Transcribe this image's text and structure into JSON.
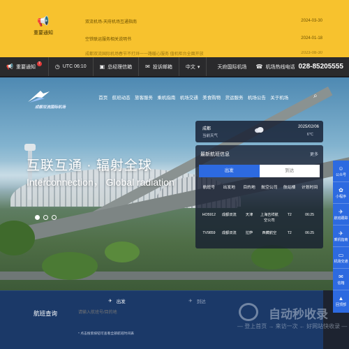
{
  "notice": {
    "label": "重要通知",
    "icon": "megaphone-icon",
    "items": [
      {
        "title": "",
        "date": ""
      },
      {
        "title": "双流机场-天府机场互通指南",
        "date": "2024-03-30"
      },
      {
        "title": "空铁联运服务相关说明书",
        "date": "2024-01-18"
      },
      {
        "title": "成都双流国际机场春节不打烊一一路暖心服务 值机柜台全面开放",
        "date": "2023-08-30"
      }
    ]
  },
  "infobar": {
    "notice": "重要通知",
    "badge": "7",
    "utc": "UTC 06:10",
    "complaint": "总经理信箱",
    "report": "投诉邮箱",
    "lang": "中文",
    "airport": "天府国际机场",
    "hotline_label": "机场热线电话",
    "hotline": "028-85205555"
  },
  "nav": {
    "logo_text": "成都双流国际机场",
    "menu": [
      "首页",
      "航班动态",
      "旅客服务",
      "乘机指南",
      "机场交通",
      "美食购物",
      "货运服务",
      "机场公告",
      "关于机场"
    ]
  },
  "hero": {
    "slogan_cn": "互联互通 · 辐射全球",
    "slogan_en": "Interconnection， Global radiation"
  },
  "weather": {
    "city": "成都",
    "condition": "当前天气",
    "date": "2025/02/06",
    "temp": "6℃"
  },
  "flights": {
    "title": "最新航班信息",
    "more": "更多",
    "tab_dep": "出发",
    "tab_arr": "到达",
    "columns": [
      "航班号",
      "出发地",
      "目的地",
      "航空公司",
      "航站楼",
      "计划时间"
    ],
    "rows": [
      [
        "HO5912",
        "成都双流",
        "天津",
        "上海吉祥航空公司",
        "T2",
        "06:25"
      ],
      [
        "TV9859",
        "成都双流",
        "拉萨",
        "西藏航空",
        "T2",
        "06:25"
      ]
    ]
  },
  "query": {
    "title": "航班查询",
    "dep": "出发",
    "arr": "到达",
    "placeholder": "请输入航班号/目的地",
    "hint": "* 点击搜索按钮可查看全部航班时间表"
  },
  "sidebar": [
    {
      "label": "公众号",
      "icon": "wechat-icon"
    },
    {
      "label": "小程序",
      "icon": "mini-program-icon"
    },
    {
      "label": "航班跟踪",
      "icon": "flight-track-icon"
    },
    {
      "label": "乘机指南",
      "icon": "guide-icon"
    },
    {
      "label": "机场交通",
      "icon": "traffic-icon"
    },
    {
      "label": "信箱",
      "icon": "mail-icon"
    },
    {
      "label": "回顶部",
      "icon": "up-arrow-icon"
    }
  ],
  "watermark": {
    "big": "自动秒收录",
    "small": "— 登上首页 → 来访一次 ← 好网站快收录 —"
  }
}
